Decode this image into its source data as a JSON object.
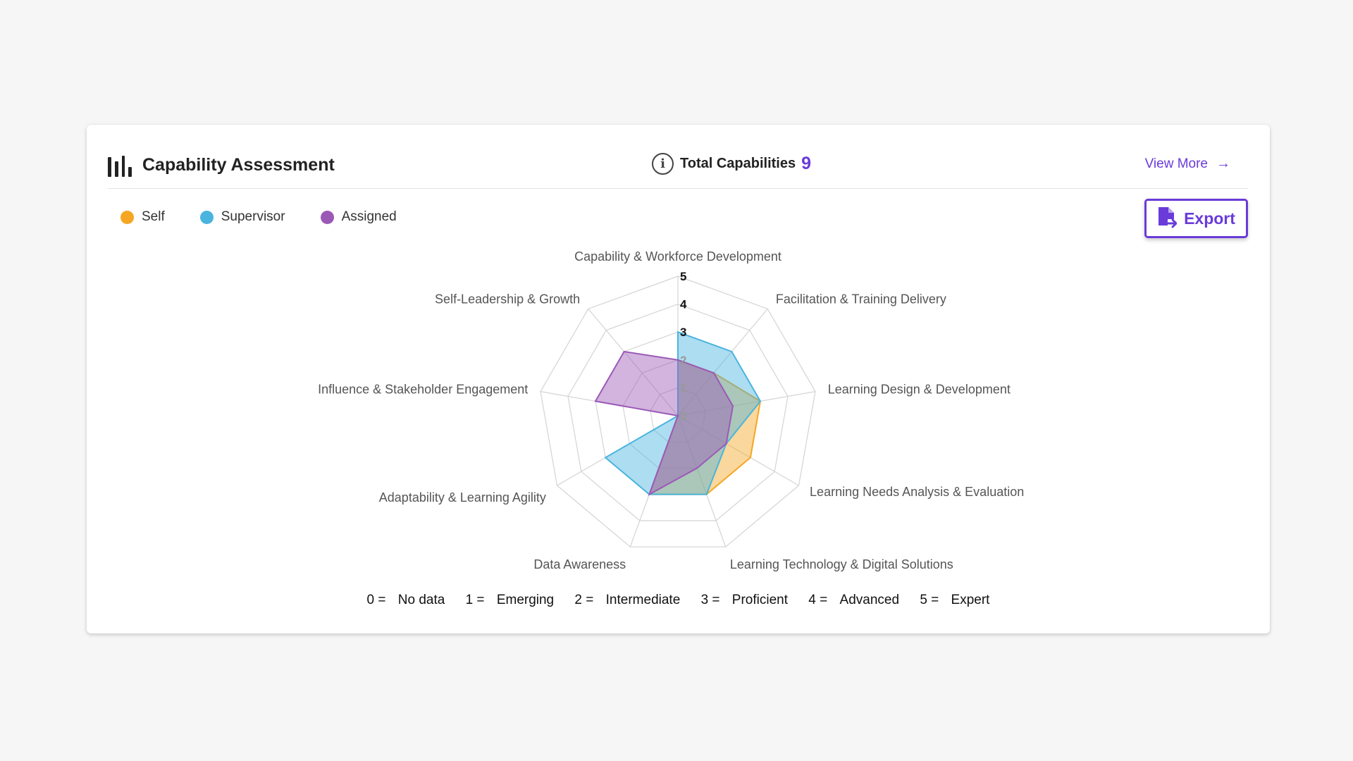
{
  "header": {
    "title": "Capability Assessment",
    "total_label": "Total Capabilities",
    "total_value": "9",
    "view_more": "View More"
  },
  "legend": [
    {
      "label": "Self",
      "color": "#f5a623"
    },
    {
      "label": "Supervisor",
      "color": "#4ab4de"
    },
    {
      "label": "Assigned",
      "color": "#9b59b6"
    }
  ],
  "export_label": "Export",
  "chart_data": {
    "type": "radar",
    "axes": [
      "Capability & Workforce Development",
      "Facilitation & Training Delivery",
      "Learning Design & Development",
      "Learning Needs Analysis & Evaluation",
      "Learning Technology & Digital Solutions",
      "Data Awareness",
      "Adaptability & Learning Agility",
      "Influence & Stakeholder Engagement",
      "Self-Leadership & Growth"
    ],
    "ticks": [
      "0",
      "1",
      "2",
      "3",
      "4",
      "5"
    ],
    "range": [
      0,
      5
    ],
    "series": [
      {
        "name": "Self",
        "color": "#f5a623",
        "values": [
          2,
          2,
          3,
          3,
          3,
          3,
          0,
          0,
          0
        ]
      },
      {
        "name": "Supervisor",
        "color": "#4ab4de",
        "values": [
          3,
          3,
          3,
          2,
          3,
          3,
          3,
          0,
          0
        ]
      },
      {
        "name": "Assigned",
        "color": "#9b59b6",
        "values": [
          2,
          2,
          2,
          2,
          2,
          3,
          0,
          3,
          3
        ]
      }
    ]
  },
  "scale": [
    {
      "key": "0 =",
      "label": "No data"
    },
    {
      "key": "1 =",
      "label": "Emerging"
    },
    {
      "key": "2 =",
      "label": "Intermediate"
    },
    {
      "key": "3 =",
      "label": "Proficient"
    },
    {
      "key": "4 =",
      "label": "Advanced"
    },
    {
      "key": "5 =",
      "label": "Expert"
    }
  ]
}
